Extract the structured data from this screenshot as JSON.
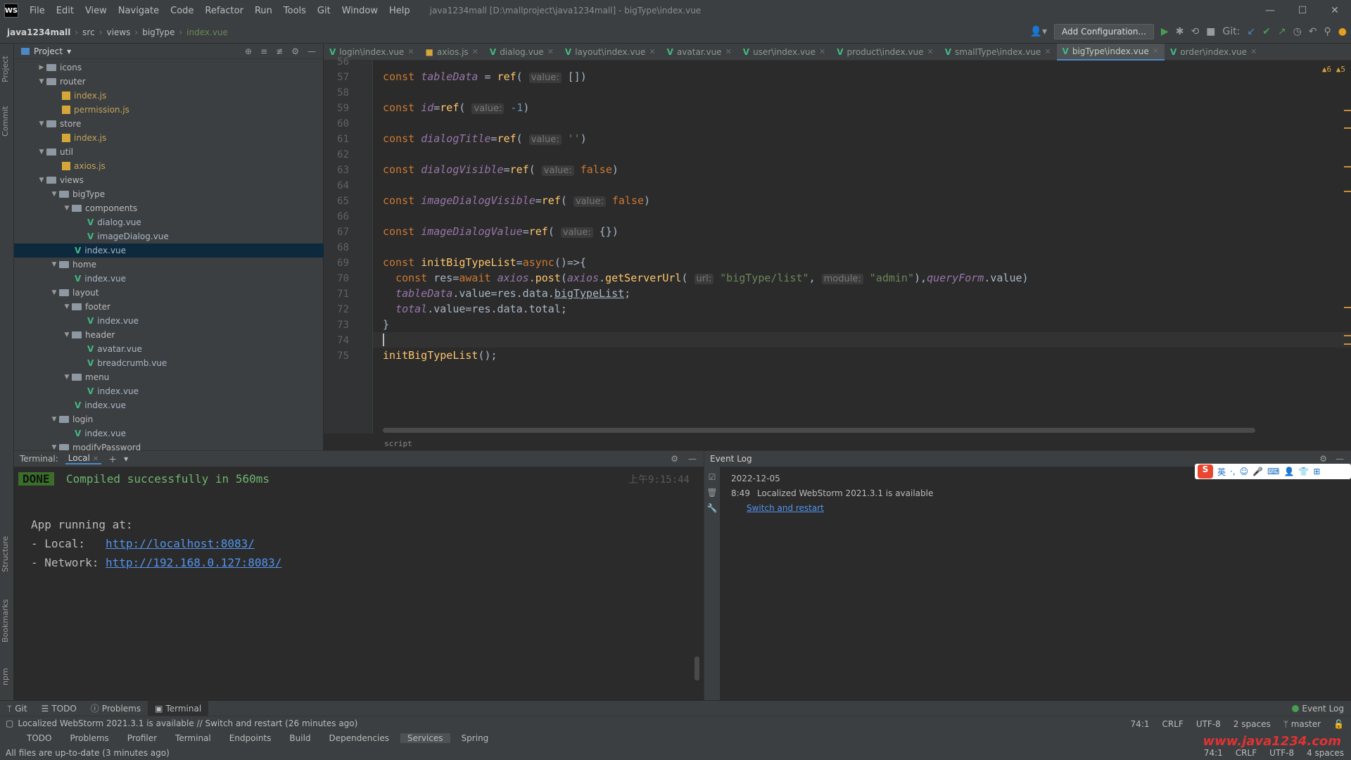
{
  "menubar": {
    "logo": "WS",
    "items": [
      "File",
      "Edit",
      "View",
      "Navigate",
      "Code",
      "Refactor",
      "Run",
      "Tools",
      "Git",
      "Window",
      "Help"
    ],
    "title": "java1234mall [D:\\mallproject\\java1234mall] - bigType\\index.vue"
  },
  "navbar": {
    "crumbs": [
      "java1234mall",
      "src",
      "views",
      "bigType",
      "index.vue"
    ],
    "add_config": "Add Configuration...",
    "git_label": "Git:"
  },
  "project": {
    "title": "Project",
    "tree": [
      {
        "label": "icons",
        "kind": "folder",
        "level": 2,
        "open": false
      },
      {
        "label": "router",
        "kind": "folder",
        "level": 2,
        "open": true
      },
      {
        "label": "index.js",
        "kind": "js",
        "level": 4
      },
      {
        "label": "permission.js",
        "kind": "js",
        "level": 4
      },
      {
        "label": "store",
        "kind": "folder",
        "level": 2,
        "open": true
      },
      {
        "label": "index.js",
        "kind": "js",
        "level": 4
      },
      {
        "label": "util",
        "kind": "folder",
        "level": 2,
        "open": true
      },
      {
        "label": "axios.js",
        "kind": "js",
        "level": 4
      },
      {
        "label": "views",
        "kind": "folder",
        "level": 2,
        "open": true
      },
      {
        "label": "bigType",
        "kind": "folder",
        "level": 3,
        "open": true
      },
      {
        "label": "components",
        "kind": "folder",
        "level": 4,
        "open": true
      },
      {
        "label": "dialog.vue",
        "kind": "vue",
        "level": 6
      },
      {
        "label": "imageDialog.vue",
        "kind": "vue",
        "level": 6
      },
      {
        "label": "index.vue",
        "kind": "vue",
        "level": 5,
        "selected": true
      },
      {
        "label": "home",
        "kind": "folder",
        "level": 3,
        "open": true
      },
      {
        "label": "index.vue",
        "kind": "vue",
        "level": 5
      },
      {
        "label": "layout",
        "kind": "folder",
        "level": 3,
        "open": true
      },
      {
        "label": "footer",
        "kind": "folder",
        "level": 4,
        "open": true
      },
      {
        "label": "index.vue",
        "kind": "vue",
        "level": 6
      },
      {
        "label": "header",
        "kind": "folder",
        "level": 4,
        "open": true
      },
      {
        "label": "avatar.vue",
        "kind": "vue",
        "level": 6
      },
      {
        "label": "breadcrumb.vue",
        "kind": "vue",
        "level": 6
      },
      {
        "label": "menu",
        "kind": "folder",
        "level": 4,
        "open": true
      },
      {
        "label": "index.vue",
        "kind": "vue",
        "level": 6
      },
      {
        "label": "index.vue",
        "kind": "vue",
        "level": 5
      },
      {
        "label": "login",
        "kind": "folder",
        "level": 3,
        "open": true
      },
      {
        "label": "index.vue",
        "kind": "vue",
        "level": 5
      },
      {
        "label": "modifyPassword",
        "kind": "folder",
        "level": 3,
        "open": true
      }
    ]
  },
  "tabs": [
    {
      "label": "login\\index.vue",
      "kind": "vue"
    },
    {
      "label": "axios.js",
      "kind": "js"
    },
    {
      "label": "dialog.vue",
      "kind": "vue"
    },
    {
      "label": "layout\\index.vue",
      "kind": "vue"
    },
    {
      "label": "avatar.vue",
      "kind": "vue"
    },
    {
      "label": "user\\index.vue",
      "kind": "vue"
    },
    {
      "label": "product\\index.vue",
      "kind": "vue"
    },
    {
      "label": "smallType\\index.vue",
      "kind": "vue"
    },
    {
      "label": "bigType\\index.vue",
      "kind": "vue",
      "active": true
    },
    {
      "label": "order\\index.vue",
      "kind": "vue"
    }
  ],
  "editor": {
    "warnings": "▲6 ▲5",
    "breadcrumb": "script",
    "line_numbers": [
      "56",
      "57",
      "58",
      "59",
      "60",
      "61",
      "62",
      "63",
      "64",
      "65",
      "66",
      "67",
      "68",
      "69",
      "70",
      "71",
      "72",
      "73",
      "74",
      "75"
    ],
    "lines": [
      {
        "n": "56",
        "html": ""
      },
      {
        "n": "57",
        "html": "<span class=\"kw\">const </span><span class=\"var\">tableData</span> = <span class=\"fn\">ref</span>( <span class=\"hint\">value:</span> [])"
      },
      {
        "n": "58",
        "html": ""
      },
      {
        "n": "59",
        "html": "<span class=\"kw\">const </span><span class=\"var\">id</span>=<span class=\"fn\">ref</span>( <span class=\"hint\">value:</span> <span class=\"num\">-1</span>)"
      },
      {
        "n": "60",
        "html": ""
      },
      {
        "n": "61",
        "html": "<span class=\"kw\">const </span><span class=\"var\">dialogTitle</span>=<span class=\"fn\">ref</span>( <span class=\"hint\">value:</span> <span class=\"str\">''</span>)"
      },
      {
        "n": "62",
        "html": ""
      },
      {
        "n": "63",
        "html": "<span class=\"kw\">const </span><span class=\"var\">dialogVisible</span>=<span class=\"fn\">ref</span>( <span class=\"hint\">value:</span> <span class=\"kw\">false</span>)"
      },
      {
        "n": "64",
        "html": ""
      },
      {
        "n": "65",
        "html": "<span class=\"kw\">const </span><span class=\"var\">imageDialogVisible</span>=<span class=\"fn\">ref</span>( <span class=\"hint\">value:</span> <span class=\"kw\">false</span>)"
      },
      {
        "n": "66",
        "html": ""
      },
      {
        "n": "67",
        "html": "<span class=\"kw\">const </span><span class=\"var\">imageDialogValue</span>=<span class=\"fn\">ref</span>( <span class=\"hint\">value:</span> {})"
      },
      {
        "n": "68",
        "html": ""
      },
      {
        "n": "69",
        "html": "<span class=\"kw\">const </span><span class=\"fn\">initBigTypeList</span>=<span class=\"kw\">async</span>()=>{"
      },
      {
        "n": "70",
        "html": "  <span class=\"kw\">const </span>res=<span class=\"kw\">await </span><span class=\"var\">axios</span>.<span class=\"fn\">post</span>(<span class=\"var\">axios</span>.<span class=\"fn\">getServerUrl</span>( <span class=\"hint\">url:</span> <span class=\"str\">\"bigType/list\"</span>, <span class=\"hint\">module:</span> <span class=\"str\">\"admin\"</span>),<span class=\"var\">queryForm</span>.value)"
      },
      {
        "n": "71",
        "html": "  <span class=\"var\">tableData</span>.value=res.data.<span class=\"ul\">bigTypeList</span>;"
      },
      {
        "n": "72",
        "html": "  <span class=\"var\">total</span>.value=res.data.total;"
      },
      {
        "n": "73",
        "html": "}"
      },
      {
        "n": "74",
        "html": ""
      },
      {
        "n": "75",
        "html": "<span class=\"fn\">initBigTypeList</span>();"
      }
    ],
    "current_line": "74"
  },
  "terminal": {
    "title": "Terminal:",
    "tab": "Local",
    "done": "DONE",
    "compiled": "Compiled successfully in 560ms",
    "time": "上午9:15:44",
    "app_running": "App running at:",
    "local_label": "- Local:   ",
    "local_url": "http://localhost:8083/",
    "network_label": "- Network: ",
    "network_url": "http://192.168.0.127:8083/"
  },
  "eventlog": {
    "title": "Event Log",
    "date": "2022-12-05",
    "time": "8:49",
    "message": "Localized WebStorm 2021.3.1 is available",
    "action": "Switch and restart"
  },
  "ime": {
    "logo": "S",
    "items": [
      "英",
      "·,",
      "☺",
      "🎤",
      "⌨",
      "👤",
      "👕",
      "⊞"
    ]
  },
  "toolwindows": {
    "items": [
      "Git",
      "TODO",
      "Problems",
      "Terminal"
    ],
    "active": "Terminal",
    "right": "Event Log"
  },
  "status": {
    "notice": "Localized WebStorm 2021.3.1 is available // Switch and restart (26 minutes ago)",
    "position": "74:1",
    "line_sep": "CRLF",
    "encoding": "UTF-8",
    "indent": "2 spaces",
    "branch": "master",
    "services": [
      "TODO",
      "Problems",
      "Profiler",
      "Terminal",
      "Endpoints",
      "Build",
      "Dependencies",
      "Services",
      "Spring"
    ],
    "services_active": "Services",
    "files_status": "All files are up-to-date (3 minutes ago)",
    "indent2": "4 spaces",
    "watermark": "www.java1234.com"
  }
}
